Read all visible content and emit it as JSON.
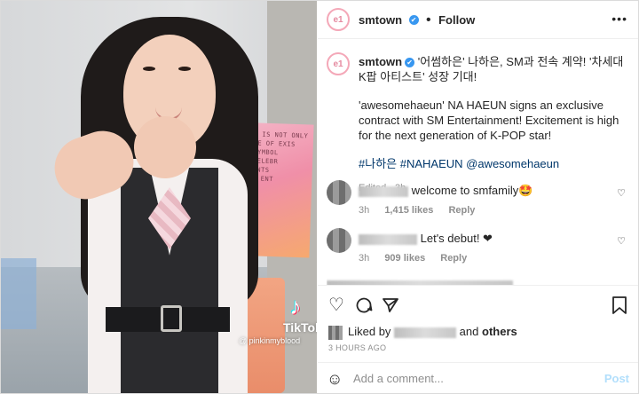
{
  "post": {
    "username": "smtown",
    "verified_icon": "check",
    "follow_label": "Follow",
    "more_label": "•••",
    "avatar_label": "e1"
  },
  "media": {
    "sign_text": "LIGHT IS NOT ONLY\nSOURCE OF EXIS\nBUT SYMBOL\nTHE CELEBR\nCONTENTS\nBY SM ENT",
    "tiktok_logo": "♪",
    "tiktok_name": "TikTok",
    "tiktok_handle": "@ pinkinmyblood"
  },
  "caption": {
    "username": "smtown",
    "korean": "'어썸하은' 나하은, SM과 전속 계약! '차세대 K팝 아티스트' 성장 기대!",
    "english": "'awesomehaeun' NA HAEUN signs an exclusive contract with SM Entertainment! Excitement is high for the next generation of K-POP star!",
    "tags": "#나하은 #NAHAEUN @awesomehaeun",
    "edited": "Edited · 3h"
  },
  "comments": [
    {
      "text": "welcome to smfamily🤩",
      "time": "3h",
      "likes": "1,415 likes",
      "reply": "Reply"
    },
    {
      "text": "Let's debut! ❤",
      "time": "3h",
      "likes": "909 likes",
      "reply": "Reply"
    }
  ],
  "actions": {
    "liked_by_prefix": "Liked by",
    "liked_by_suffix": "and",
    "others": "others",
    "timestamp": "3 HOURS AGO",
    "add_comment_placeholder": "Add a comment...",
    "post_label": "Post"
  },
  "colors": {
    "link": "#00376b",
    "verified": "#3897f0",
    "post_disabled": "#b2dffc"
  }
}
